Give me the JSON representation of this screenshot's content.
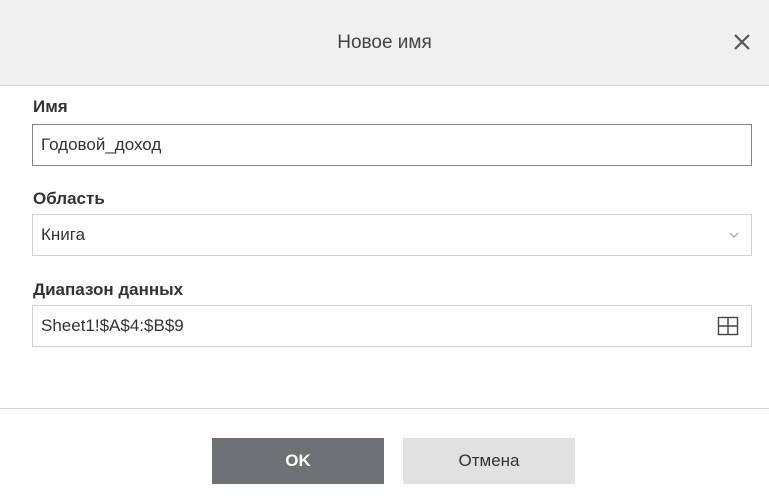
{
  "dialog": {
    "title": "Новое имя",
    "close_icon": "close-icon"
  },
  "name_field": {
    "label": "Имя",
    "value": "Годовой_доход"
  },
  "scope_field": {
    "label": "Область",
    "value": "Книга",
    "icon": "chevron-down-icon"
  },
  "range_field": {
    "label": "Диапазон данных",
    "value": "Sheet1!$A$4:$B$9",
    "icon": "grid-icon"
  },
  "buttons": {
    "ok_label": "OK",
    "cancel_label": "Отмена"
  },
  "colors": {
    "ok_button_bg": "#6f7275",
    "cancel_button_bg": "#e1e1e1",
    "titlebar_bg": "#f0f0f0"
  }
}
